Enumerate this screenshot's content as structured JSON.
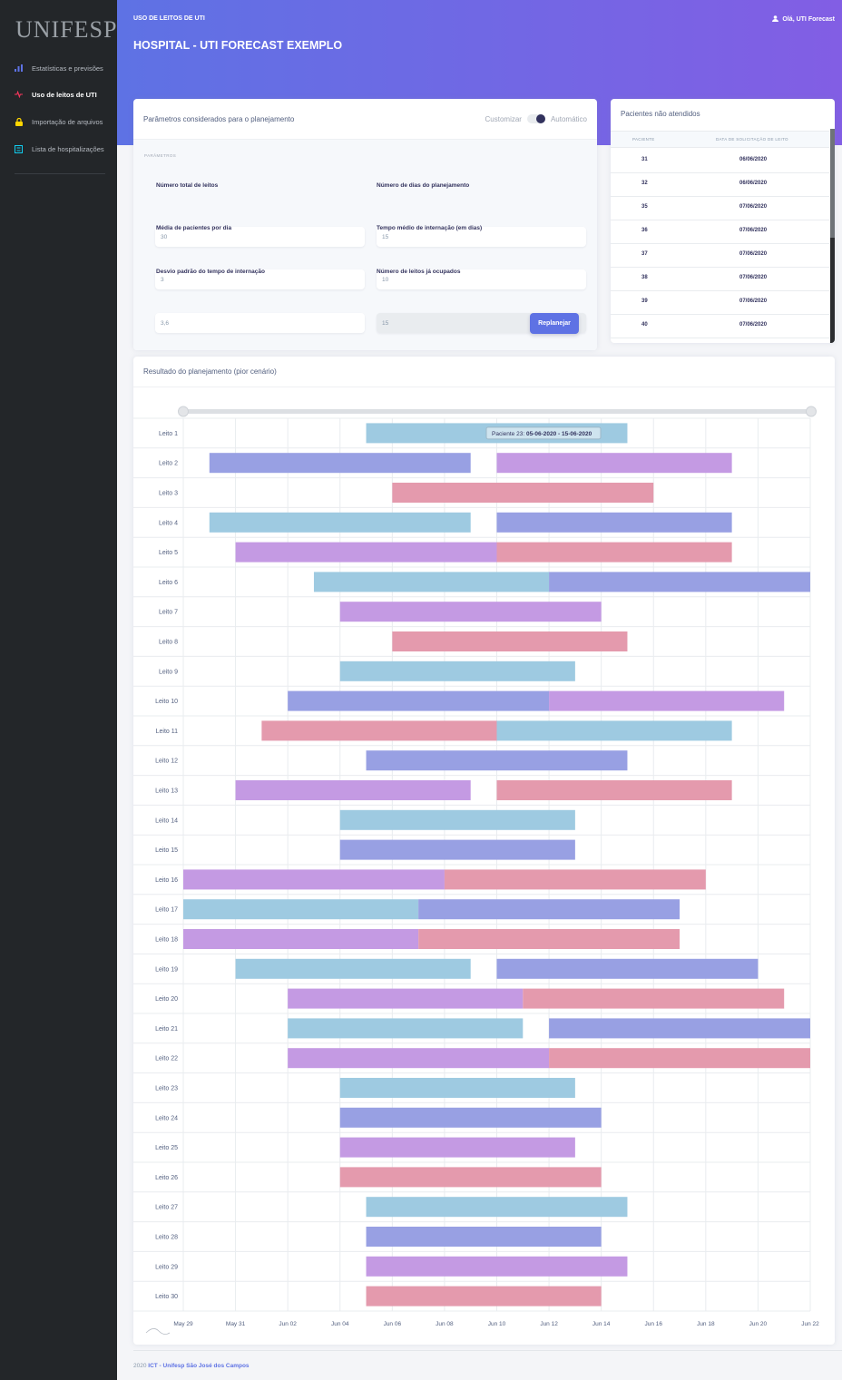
{
  "sidebar": {
    "logo": "UNIFESP",
    "items": [
      {
        "label": "Estatísticas e previsões",
        "icon": "bar-chart-icon",
        "color": "#5e72e4",
        "active": false
      },
      {
        "label": "Uso de leitos de UTI",
        "icon": "heartbeat-icon",
        "color": "#f5365c",
        "active": true
      },
      {
        "label": "Importação de arquivos",
        "icon": "lock-icon",
        "color": "#ffd600",
        "active": false
      },
      {
        "label": "Lista de hospitalizações",
        "icon": "list-box-icon",
        "color": "#11cdef",
        "active": false
      }
    ]
  },
  "header": {
    "section": "USO DE LEITOS DE UTI",
    "title": "HOSPITAL - UTI FORECAST EXEMPLO",
    "user": "Olá, UTI Forecast",
    "gradient_from": "#5e72e4",
    "gradient_to": "#825ee4"
  },
  "params": {
    "title": "Parâmetros considerados para o planejamento",
    "toggle_left": "Customizar",
    "toggle_right": "Automático",
    "section": "PARÂMETROS",
    "fields": [
      {
        "label": "Número total de leitos",
        "value": "30",
        "disabled": false
      },
      {
        "label": "Número de dias do planejamento",
        "value": "15",
        "disabled": false
      },
      {
        "label": "Média de pacientes por dia",
        "value": "3",
        "disabled": false
      },
      {
        "label": "Tempo médio de internação (em dias)",
        "value": "10",
        "disabled": false
      },
      {
        "label": "Desvio padrão do tempo de internação",
        "value": "3,6",
        "disabled": false
      },
      {
        "label": "Número de leitos já ocupados",
        "value": "15",
        "disabled": true
      }
    ],
    "button": "Replanejar"
  },
  "patients": {
    "title": "Pacientes não atendidos",
    "col_patient": "PACIENTE",
    "col_date": "DATA DE SOLICITAÇÃO DE LEITO",
    "rows": [
      {
        "id": "31",
        "date": "06/06/2020"
      },
      {
        "id": "32",
        "date": "06/06/2020"
      },
      {
        "id": "35",
        "date": "07/06/2020"
      },
      {
        "id": "36",
        "date": "07/06/2020"
      },
      {
        "id": "37",
        "date": "07/06/2020"
      },
      {
        "id": "38",
        "date": "07/06/2020"
      },
      {
        "id": "39",
        "date": "07/06/2020"
      },
      {
        "id": "40",
        "date": "07/06/2020"
      }
    ]
  },
  "result": {
    "title": "Resultado do planejamento (pior cenário)",
    "tooltip_prefix": "Paciente 23:",
    "tooltip_range": "05-06-2020 - 15-06-2020"
  },
  "chart_data": {
    "type": "gantt",
    "x_start": "2020-05-29",
    "x_end": "2020-06-22",
    "x_ticks": [
      "May 29",
      "May 31",
      "Jun 02",
      "Jun 04",
      "Jun 06",
      "Jun 08",
      "Jun 10",
      "Jun 12",
      "Jun 14",
      "Jun 16",
      "Jun 18",
      "Jun 20",
      "Jun 22"
    ],
    "colors": {
      "blue": "#9ecae1",
      "indigo": "#98a0e3",
      "purple": "#c49ae3",
      "pink": "#e49aad"
    },
    "rows": [
      {
        "label": "Leito 1",
        "bars": [
          {
            "start": "2020-06-05",
            "end": "2020-06-15",
            "color": "blue"
          }
        ]
      },
      {
        "label": "Leito 2",
        "bars": [
          {
            "start": "2020-05-30",
            "end": "2020-06-09",
            "color": "indigo"
          },
          {
            "start": "2020-06-10",
            "end": "2020-06-19",
            "color": "purple"
          }
        ]
      },
      {
        "label": "Leito 3",
        "bars": [
          {
            "start": "2020-06-06",
            "end": "2020-06-16",
            "color": "pink"
          }
        ]
      },
      {
        "label": "Leito 4",
        "bars": [
          {
            "start": "2020-05-30",
            "end": "2020-06-09",
            "color": "blue"
          },
          {
            "start": "2020-06-10",
            "end": "2020-06-19",
            "color": "indigo"
          }
        ]
      },
      {
        "label": "Leito 5",
        "bars": [
          {
            "start": "2020-05-31",
            "end": "2020-06-10",
            "color": "purple"
          },
          {
            "start": "2020-06-10",
            "end": "2020-06-19",
            "color": "pink"
          }
        ]
      },
      {
        "label": "Leito 6",
        "bars": [
          {
            "start": "2020-06-03",
            "end": "2020-06-12",
            "color": "blue"
          },
          {
            "start": "2020-06-12",
            "end": "2020-06-22",
            "color": "indigo"
          }
        ]
      },
      {
        "label": "Leito 7",
        "bars": [
          {
            "start": "2020-06-04",
            "end": "2020-06-14",
            "color": "purple"
          }
        ]
      },
      {
        "label": "Leito 8",
        "bars": [
          {
            "start": "2020-06-06",
            "end": "2020-06-15",
            "color": "pink"
          }
        ]
      },
      {
        "label": "Leito 9",
        "bars": [
          {
            "start": "2020-06-04",
            "end": "2020-06-13",
            "color": "blue"
          }
        ]
      },
      {
        "label": "Leito 10",
        "bars": [
          {
            "start": "2020-06-02",
            "end": "2020-06-12",
            "color": "indigo"
          },
          {
            "start": "2020-06-12",
            "end": "2020-06-21",
            "color": "purple"
          }
        ]
      },
      {
        "label": "Leito 11",
        "bars": [
          {
            "start": "2020-06-01",
            "end": "2020-06-10",
            "color": "pink"
          },
          {
            "start": "2020-06-10",
            "end": "2020-06-19",
            "color": "blue"
          }
        ]
      },
      {
        "label": "Leito 12",
        "bars": [
          {
            "start": "2020-06-05",
            "end": "2020-06-15",
            "color": "indigo"
          }
        ]
      },
      {
        "label": "Leito 13",
        "bars": [
          {
            "start": "2020-05-31",
            "end": "2020-06-09",
            "color": "purple"
          },
          {
            "start": "2020-06-10",
            "end": "2020-06-19",
            "color": "pink"
          }
        ]
      },
      {
        "label": "Leito 14",
        "bars": [
          {
            "start": "2020-06-04",
            "end": "2020-06-13",
            "color": "blue"
          }
        ]
      },
      {
        "label": "Leito 15",
        "bars": [
          {
            "start": "2020-06-04",
            "end": "2020-06-13",
            "color": "indigo"
          }
        ]
      },
      {
        "label": "Leito 16",
        "bars": [
          {
            "start": "2020-05-29",
            "end": "2020-06-08",
            "color": "purple"
          },
          {
            "start": "2020-06-08",
            "end": "2020-06-18",
            "color": "pink"
          }
        ]
      },
      {
        "label": "Leito 17",
        "bars": [
          {
            "start": "2020-05-29",
            "end": "2020-06-07",
            "color": "blue"
          },
          {
            "start": "2020-06-07",
            "end": "2020-06-17",
            "color": "indigo"
          }
        ]
      },
      {
        "label": "Leito 18",
        "bars": [
          {
            "start": "2020-05-29",
            "end": "2020-06-07",
            "color": "purple"
          },
          {
            "start": "2020-06-07",
            "end": "2020-06-17",
            "color": "pink"
          }
        ]
      },
      {
        "label": "Leito 19",
        "bars": [
          {
            "start": "2020-05-31",
            "end": "2020-06-09",
            "color": "blue"
          },
          {
            "start": "2020-06-10",
            "end": "2020-06-20",
            "color": "indigo"
          }
        ]
      },
      {
        "label": "Leito 20",
        "bars": [
          {
            "start": "2020-06-02",
            "end": "2020-06-11",
            "color": "purple"
          },
          {
            "start": "2020-06-11",
            "end": "2020-06-21",
            "color": "pink"
          }
        ]
      },
      {
        "label": "Leito 21",
        "bars": [
          {
            "start": "2020-06-02",
            "end": "2020-06-11",
            "color": "blue"
          },
          {
            "start": "2020-06-12",
            "end": "2020-06-22",
            "color": "indigo"
          }
        ]
      },
      {
        "label": "Leito 22",
        "bars": [
          {
            "start": "2020-06-02",
            "end": "2020-06-12",
            "color": "purple"
          },
          {
            "start": "2020-06-12",
            "end": "2020-06-22",
            "color": "pink"
          }
        ]
      },
      {
        "label": "Leito 23",
        "bars": [
          {
            "start": "2020-06-04",
            "end": "2020-06-13",
            "color": "blue"
          }
        ]
      },
      {
        "label": "Leito 24",
        "bars": [
          {
            "start": "2020-06-04",
            "end": "2020-06-14",
            "color": "indigo"
          }
        ]
      },
      {
        "label": "Leito 25",
        "bars": [
          {
            "start": "2020-06-04",
            "end": "2020-06-13",
            "color": "purple"
          }
        ]
      },
      {
        "label": "Leito 26",
        "bars": [
          {
            "start": "2020-06-04",
            "end": "2020-06-14",
            "color": "pink"
          }
        ]
      },
      {
        "label": "Leito 27",
        "bars": [
          {
            "start": "2020-06-05",
            "end": "2020-06-15",
            "color": "blue"
          }
        ]
      },
      {
        "label": "Leito 28",
        "bars": [
          {
            "start": "2020-06-05",
            "end": "2020-06-14",
            "color": "indigo"
          }
        ]
      },
      {
        "label": "Leito 29",
        "bars": [
          {
            "start": "2020-06-05",
            "end": "2020-06-15",
            "color": "purple"
          }
        ]
      },
      {
        "label": "Leito 30",
        "bars": [
          {
            "start": "2020-06-05",
            "end": "2020-06-14",
            "color": "pink"
          }
        ]
      }
    ]
  },
  "footer": {
    "year": "2020",
    "link": "ICT - Unifesp São José dos Campos"
  }
}
